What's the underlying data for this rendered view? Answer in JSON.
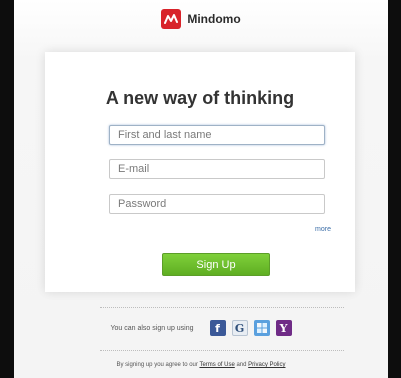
{
  "brand": {
    "name": "Mindomo",
    "logo_color": "#d8232a"
  },
  "form": {
    "headline": "A new way of thinking",
    "name_placeholder": "First and last name",
    "email_placeholder": "E-mail",
    "password_placeholder": "Password",
    "more_link": "more",
    "signup_label": "Sign Up"
  },
  "social": {
    "prompt": "You can also sign up using",
    "providers": [
      {
        "name": "facebook",
        "glyph": "f",
        "icon": "facebook-icon"
      },
      {
        "name": "google",
        "glyph": "G",
        "icon": "google-icon"
      },
      {
        "name": "windows-live",
        "glyph": "",
        "icon": "windows-live-icon"
      },
      {
        "name": "yahoo",
        "glyph": "Y",
        "icon": "yahoo-icon"
      }
    ]
  },
  "terms": {
    "prefix": "By signing up you agree to our",
    "terms_link": "Terms of Use",
    "and": "and",
    "privacy_link": "Privacy Policy"
  },
  "colors": {
    "accent_green": "#6cbf2c",
    "link_blue": "#3d6fa8"
  }
}
